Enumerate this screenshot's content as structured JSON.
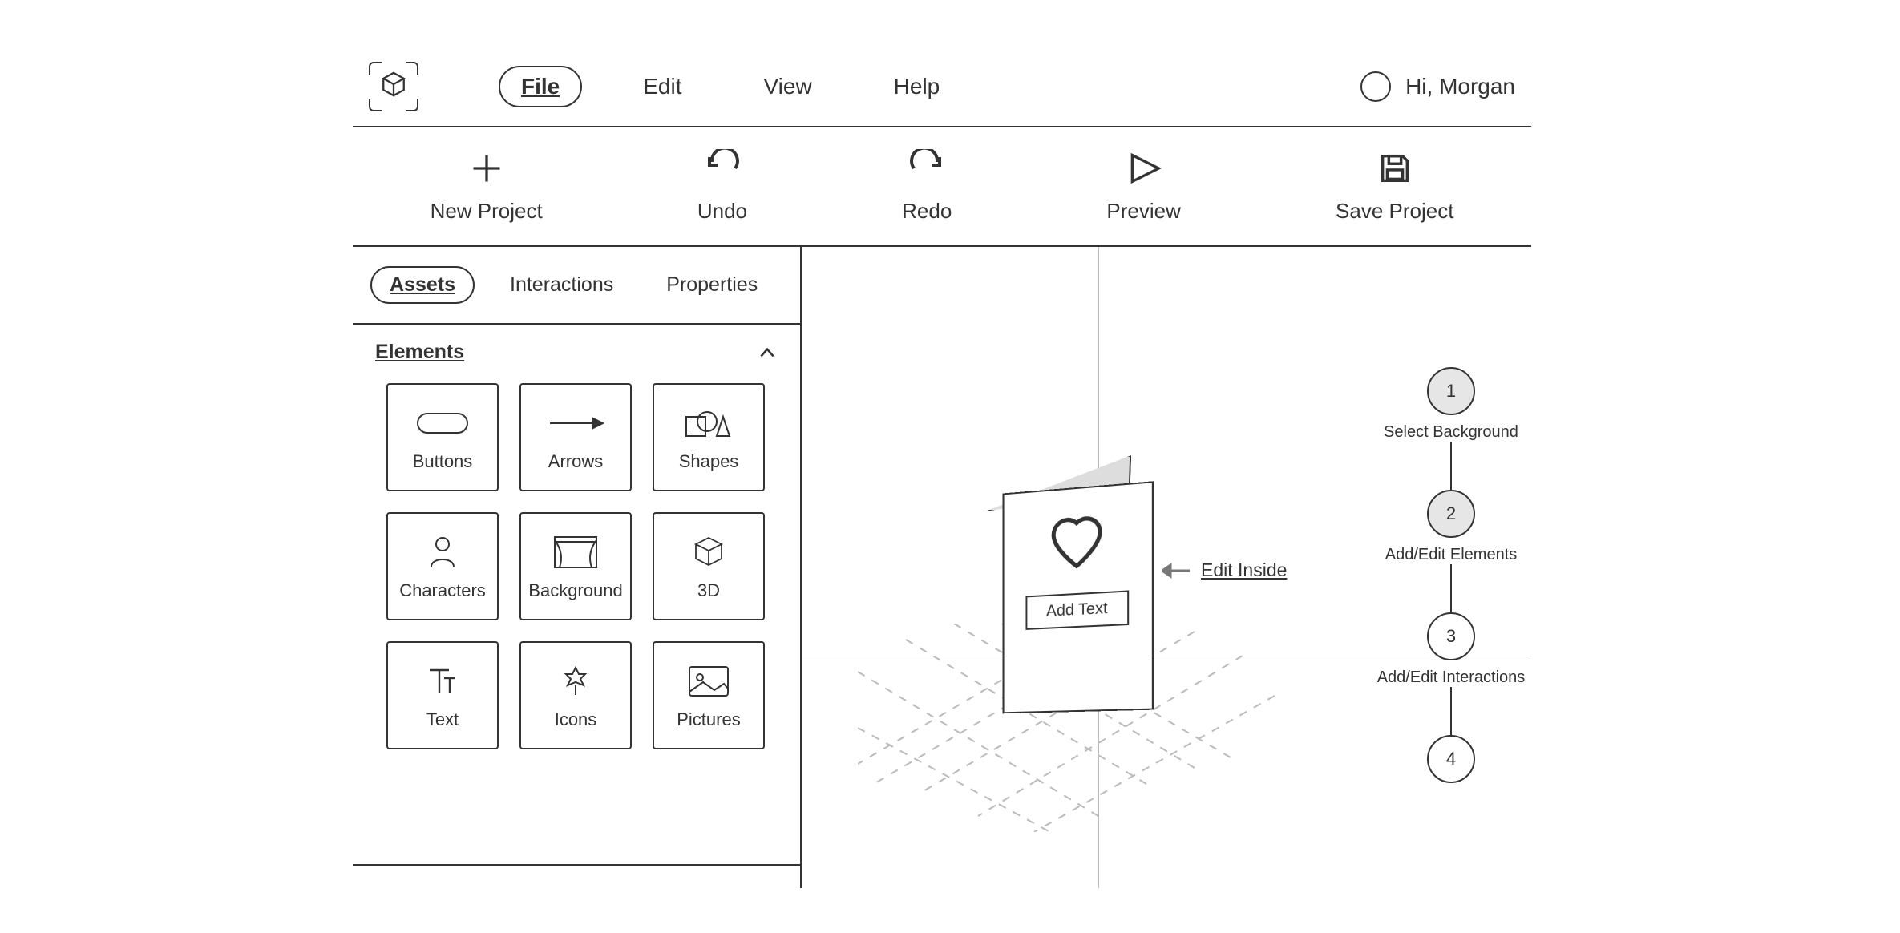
{
  "menu": {
    "items": [
      {
        "label": "File",
        "active": true
      },
      {
        "label": "Edit",
        "active": false
      },
      {
        "label": "View",
        "active": false
      },
      {
        "label": "Help",
        "active": false
      }
    ]
  },
  "user": {
    "greeting": "Hi, Morgan"
  },
  "toolbar": {
    "items": [
      {
        "label": "New Project",
        "icon": "plus"
      },
      {
        "label": "Undo",
        "icon": "undo"
      },
      {
        "label": "Redo",
        "icon": "redo"
      },
      {
        "label": "Preview",
        "icon": "play"
      },
      {
        "label": "Save Project",
        "icon": "save"
      }
    ]
  },
  "left_panel": {
    "tabs": [
      {
        "label": "Assets",
        "active": true
      },
      {
        "label": "Interactions",
        "active": false
      },
      {
        "label": "Properties",
        "active": false
      }
    ],
    "section_title": "Elements",
    "elements": [
      {
        "label": "Buttons",
        "icon": "button-pill"
      },
      {
        "label": "Arrows",
        "icon": "arrow-right"
      },
      {
        "label": "Shapes",
        "icon": "shapes"
      },
      {
        "label": "Characters",
        "icon": "person"
      },
      {
        "label": "Background",
        "icon": "curtains"
      },
      {
        "label": "3D",
        "icon": "cube"
      },
      {
        "label": "Text",
        "icon": "text-t"
      },
      {
        "label": "Icons",
        "icon": "leaf"
      },
      {
        "label": "Pictures",
        "icon": "image"
      }
    ]
  },
  "canvas": {
    "add_text_label": "Add Text",
    "edit_inside_label": "Edit Inside"
  },
  "steps": [
    {
      "num": "1",
      "label": "Select Background",
      "done": true
    },
    {
      "num": "2",
      "label": "Add/Edit Elements",
      "done": true
    },
    {
      "num": "3",
      "label": "Add/Edit Interactions",
      "done": false
    },
    {
      "num": "4",
      "label": "",
      "done": false
    }
  ]
}
